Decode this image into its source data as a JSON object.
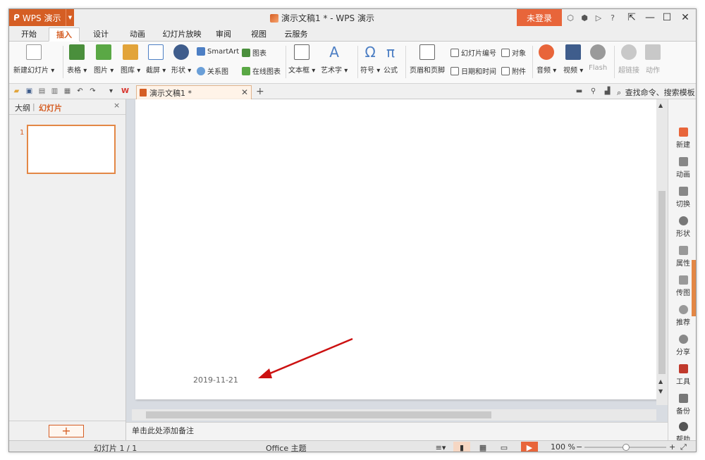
{
  "window": {
    "app_button": "WPS 演示",
    "title": "演示文稿1 * - WPS 演示",
    "login_button": "未登录",
    "help_icon": "?"
  },
  "menu": {
    "tabs": [
      {
        "label": "开始"
      },
      {
        "label": "插入",
        "active": true
      },
      {
        "label": "设计"
      },
      {
        "label": "动画"
      },
      {
        "label": "幻灯片放映"
      },
      {
        "label": "审阅"
      },
      {
        "label": "视图"
      },
      {
        "label": "云服务"
      }
    ]
  },
  "ribbon": {
    "new_slide": "新建幻灯片",
    "table": "表格",
    "picture": "图片",
    "gallery": "图库",
    "screenshot": "截屏",
    "shapes": "形状",
    "smartart": "SmartArt",
    "chart": "图表",
    "relation": "关系图",
    "online_chart": "在线图表",
    "textbox": "文本框",
    "wordart": "艺术字",
    "symbol": "符号",
    "formula": "公式",
    "header_footer": "页眉和页脚",
    "slide_number": "幻灯片编号",
    "object": "对象",
    "datetime": "日期和时间",
    "attachment": "附件",
    "audio": "音频",
    "video": "视频",
    "flash": "Flash",
    "hyperlink": "超链接",
    "action": "动作",
    "dropdown_mark": "▾"
  },
  "doc_tabs": {
    "active_doc": "演示文稿1 *",
    "add": "+",
    "search": "查找命令、搜索模板"
  },
  "left_panel": {
    "tab_outline": "大纲",
    "tab_slides": "幻灯片",
    "separator": "|",
    "slide_number": "1",
    "close": "×",
    "add_button": "+"
  },
  "slide": {
    "date_text": "2019-11-21"
  },
  "notes": {
    "placeholder": "单击此处添加备注"
  },
  "right_pane": {
    "items": [
      "新建",
      "动画",
      "切换",
      "形状",
      "属性",
      "传图",
      "推荐",
      "分享",
      "工具",
      "备份",
      "帮助"
    ]
  },
  "status": {
    "slide_info": "幻灯片 1 / 1",
    "theme": "Office 主题",
    "zoom": "100 %",
    "zoom_value": 100
  },
  "colors": {
    "accent": "#d55e24",
    "login": "#e8653a",
    "arrow": "#cc1111"
  }
}
